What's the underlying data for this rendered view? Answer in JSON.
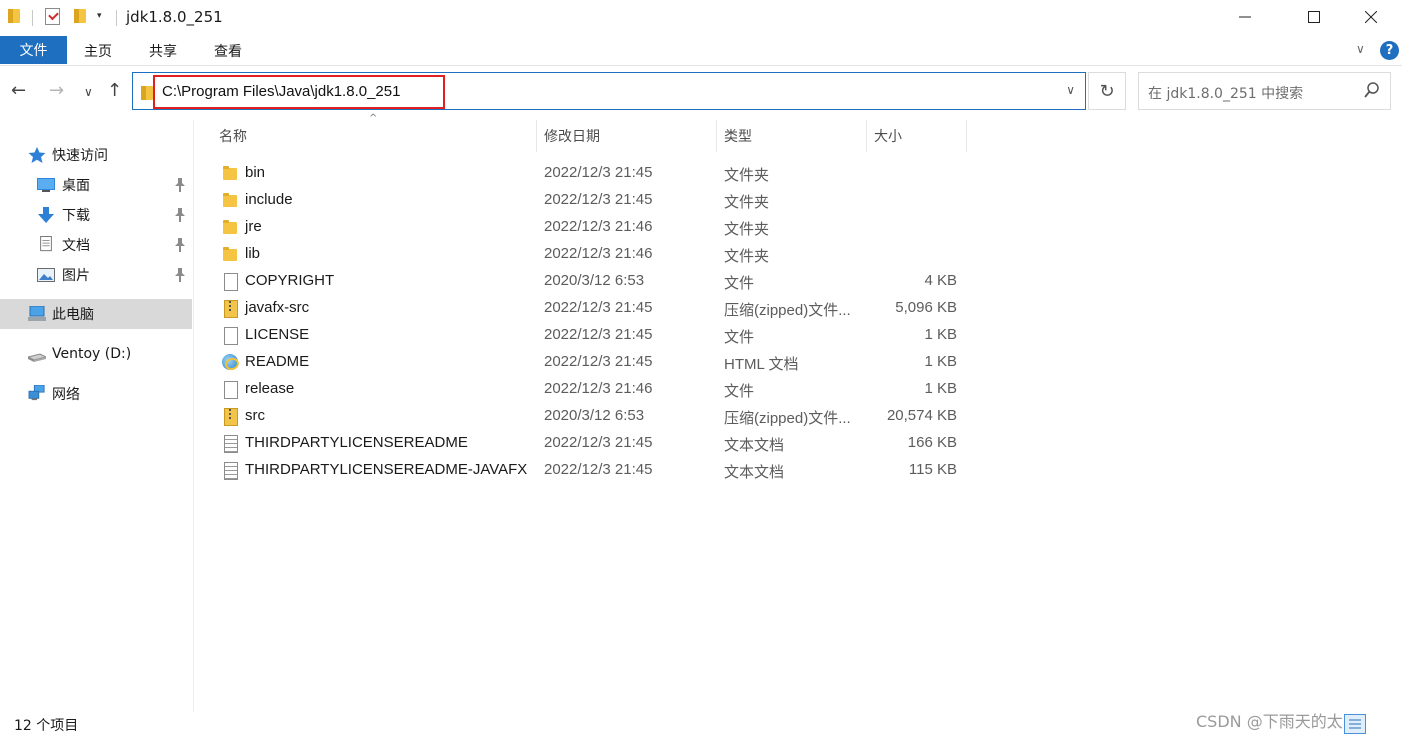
{
  "window": {
    "title": "jdk1.8.0_251",
    "minimize": "—",
    "maximize": "☐",
    "close": "✕"
  },
  "quick_access": {
    "dropdown": "▾"
  },
  "ribbon": {
    "tabs": [
      "文件",
      "主页",
      "共享",
      "查看"
    ],
    "help": "?",
    "expand": "∨"
  },
  "nav": {
    "back": "←",
    "forward": "→",
    "recent": "∨",
    "up": "↑",
    "address": "C:\\Program Files\\Java\\jdk1.8.0_251",
    "address_dropdown": "∨",
    "refresh": "↻",
    "search_placeholder": "在 jdk1.8.0_251 中搜索",
    "search_icon": "⚲"
  },
  "sidebar": {
    "items": [
      {
        "label": "快速访问",
        "icon": "star-icon"
      },
      {
        "label": "桌面",
        "icon": "desktop-icon",
        "pinned": true
      },
      {
        "label": "下载",
        "icon": "download-icon",
        "pinned": true
      },
      {
        "label": "文档",
        "icon": "document-icon",
        "pinned": true
      },
      {
        "label": "图片",
        "icon": "pictures-icon",
        "pinned": true
      },
      {
        "label": "此电脑",
        "icon": "computer-icon",
        "selected": true
      },
      {
        "label": "Ventoy (D:)",
        "icon": "drive-icon"
      },
      {
        "label": "网络",
        "icon": "network-icon"
      }
    ],
    "pin_glyph": "📌"
  },
  "columns": {
    "name": "名称",
    "date": "修改日期",
    "type": "类型",
    "size": "大小",
    "sort_indicator": "^"
  },
  "files": [
    {
      "name": "bin",
      "date": "2022/12/3 21:45",
      "type": "文件夹",
      "size": "",
      "icon": "folder-icon"
    },
    {
      "name": "include",
      "date": "2022/12/3 21:45",
      "type": "文件夹",
      "size": "",
      "icon": "folder-icon"
    },
    {
      "name": "jre",
      "date": "2022/12/3 21:46",
      "type": "文件夹",
      "size": "",
      "icon": "folder-icon"
    },
    {
      "name": "lib",
      "date": "2022/12/3 21:46",
      "type": "文件夹",
      "size": "",
      "icon": "folder-icon"
    },
    {
      "name": "COPYRIGHT",
      "date": "2020/3/12 6:53",
      "type": "文件",
      "size": "4 KB",
      "icon": "file-icon"
    },
    {
      "name": "javafx-src",
      "date": "2022/12/3 21:45",
      "type": "压缩(zipped)文件...",
      "size": "5,096 KB",
      "icon": "zip-icon"
    },
    {
      "name": "LICENSE",
      "date": "2022/12/3 21:45",
      "type": "文件",
      "size": "1 KB",
      "icon": "file-icon"
    },
    {
      "name": "README",
      "date": "2022/12/3 21:45",
      "type": "HTML 文档",
      "size": "1 KB",
      "icon": "html-icon"
    },
    {
      "name": "release",
      "date": "2022/12/3 21:46",
      "type": "文件",
      "size": "1 KB",
      "icon": "file-icon"
    },
    {
      "name": "src",
      "date": "2020/3/12 6:53",
      "type": "压缩(zipped)文件...",
      "size": "20,574 KB",
      "icon": "zip-icon"
    },
    {
      "name": "THIRDPARTYLICENSEREADME",
      "date": "2022/12/3 21:45",
      "type": "文本文档",
      "size": "166 KB",
      "icon": "text-doc-icon"
    },
    {
      "name": "THIRDPARTYLICENSEREADME-JAVAFX",
      "date": "2022/12/3 21:45",
      "type": "文本文档",
      "size": "115 KB",
      "icon": "text-doc-icon"
    }
  ],
  "status": {
    "item_count": "12 个项目"
  },
  "watermark": "CSDN @下雨天的太阳",
  "colors": {
    "accent": "#1e6fbf",
    "highlight_box": "#e02020",
    "folder": "#f6c443",
    "selected_bg": "#d9d9d9"
  }
}
